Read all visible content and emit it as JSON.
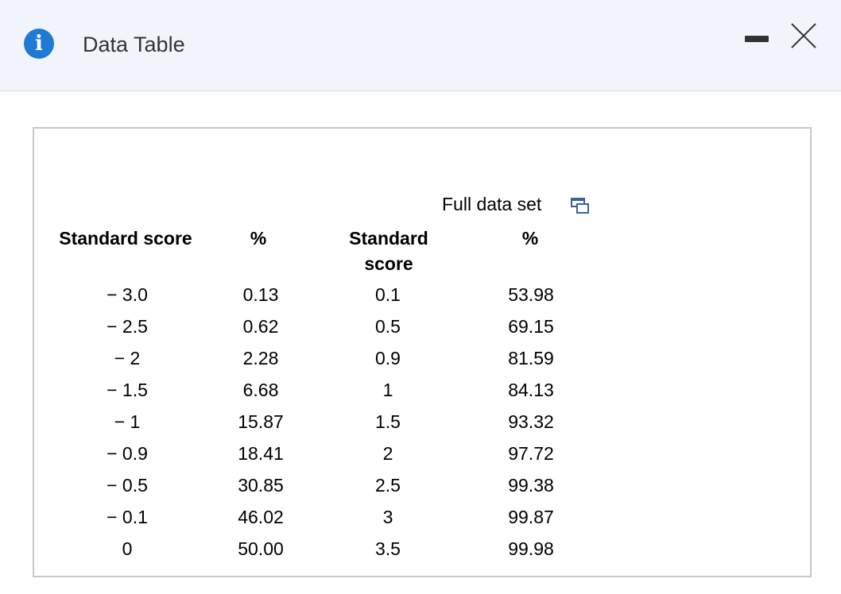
{
  "window": {
    "title": "Data Table",
    "info_icon_glyph": "i",
    "icons": [
      "info-icon",
      "minimize-icon",
      "close-icon",
      "copy-icon"
    ]
  },
  "panel": {
    "link_label": "Full data set"
  },
  "table": {
    "headers": [
      "Standard score",
      "%",
      "Standard score",
      "%"
    ],
    "left_scores": [
      "− 3.0",
      "− 2.5",
      "− 2",
      "− 1.5",
      "− 1",
      "− 0.9",
      "− 0.5",
      "− 0.1",
      "0"
    ],
    "left_pcts": [
      "0.13",
      "0.62",
      "2.28",
      "6.68",
      "15.87",
      "18.41",
      "30.85",
      "46.02",
      "50.00"
    ],
    "right_scores": [
      "0.1",
      "0.5",
      "0.9",
      "1",
      "1.5",
      "2",
      "2.5",
      "3",
      "3.5"
    ],
    "right_pcts": [
      "53.98",
      "69.15",
      "81.59",
      "84.13",
      "93.32",
      "97.72",
      "99.38",
      "99.87",
      "99.98"
    ]
  }
}
